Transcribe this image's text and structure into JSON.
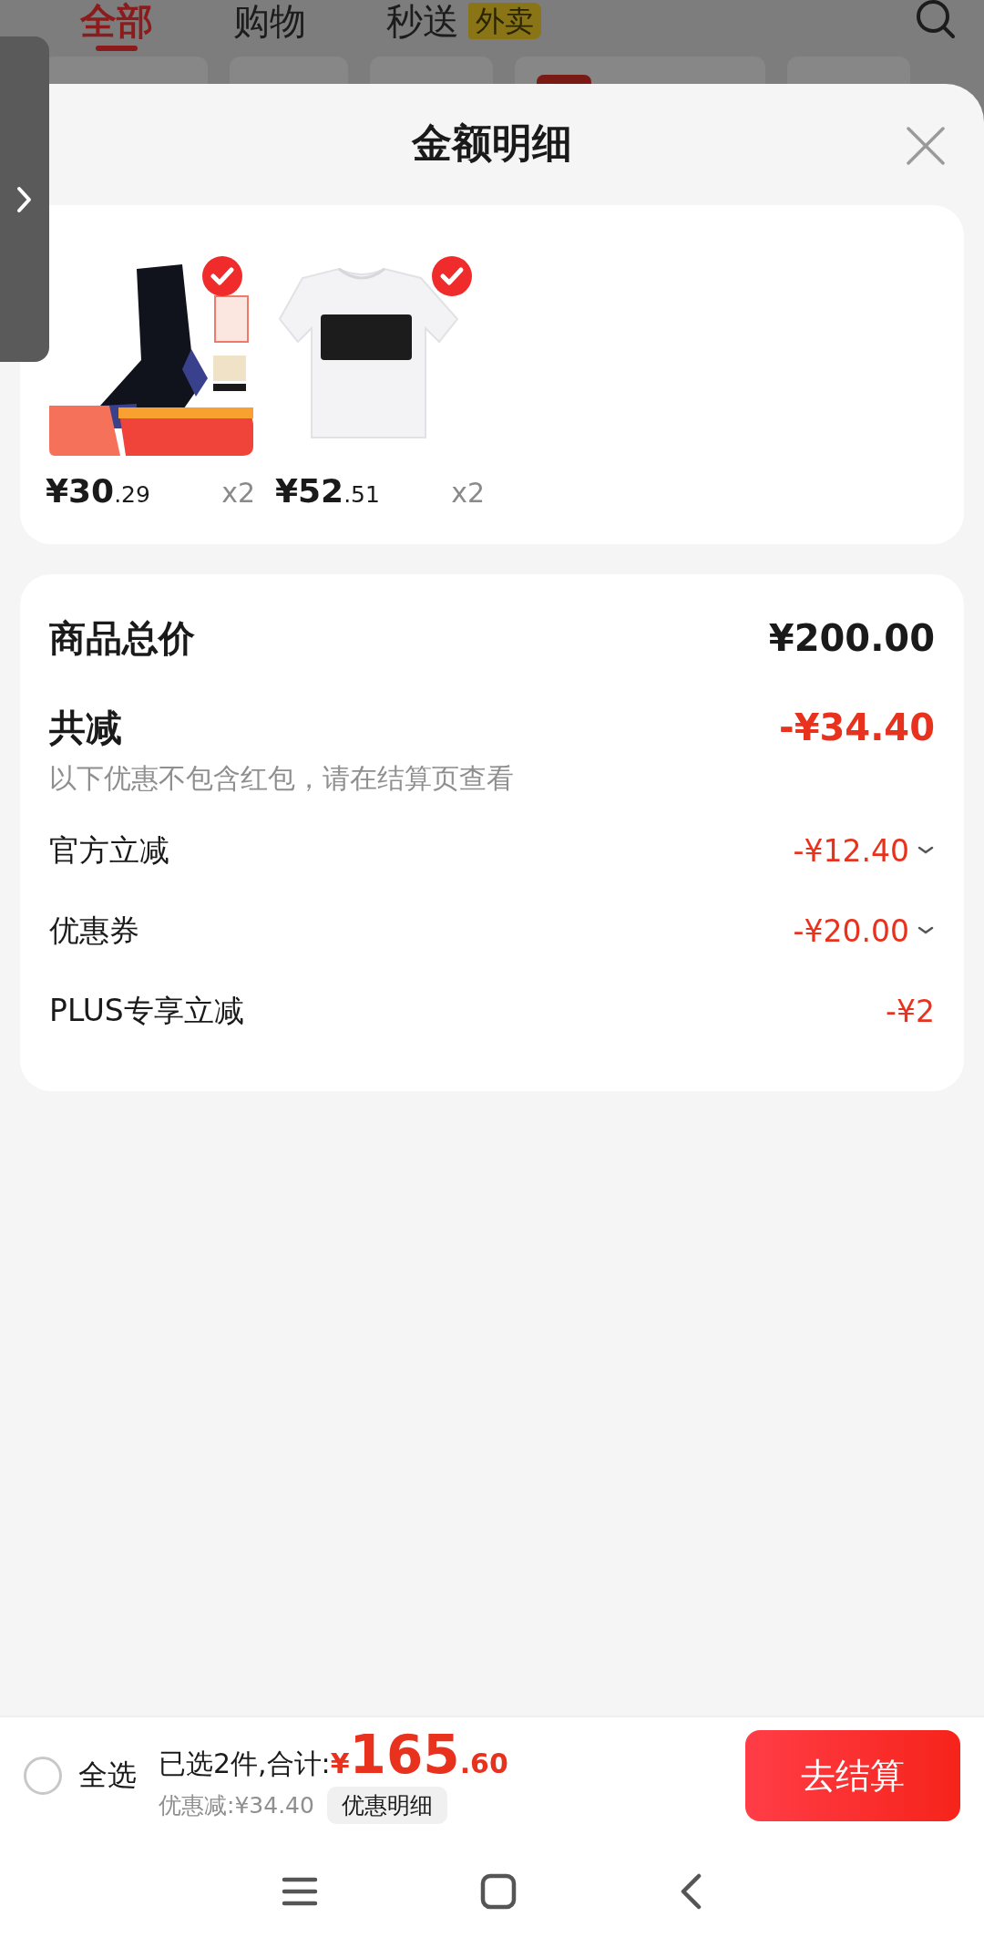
{
  "background_page": {
    "tabs": [
      {
        "label": "全部",
        "selected": true
      },
      {
        "label": "购物",
        "selected": false
      },
      {
        "label": "秒送",
        "badge": "外卖",
        "selected": false
      }
    ],
    "chips": [
      {
        "tagged": false
      },
      {
        "tagged": false
      },
      {
        "tagged": false
      },
      {
        "tagged": true
      },
      {
        "tagged": false
      }
    ]
  },
  "sheet": {
    "title": "金额明细",
    "products": [
      {
        "kind": "socks",
        "price": "¥30",
        "price_cents": ".29",
        "quantity": "x2",
        "selected": true
      },
      {
        "kind": "tshirt",
        "price": "¥52",
        "price_cents": ".51",
        "quantity": "x2",
        "selected": true
      }
    ],
    "summary": [
      {
        "kind": "total",
        "label": "商品总价",
        "amount": "¥200.00"
      },
      {
        "kind": "sum",
        "label": "共减",
        "amount": "-¥34.40",
        "note": "以下优惠不包含红包，请在结算页查看"
      },
      {
        "kind": "discount",
        "label": "官方立减",
        "amount": "-¥12.40",
        "expandable": true
      },
      {
        "kind": "discount",
        "label": "优惠券",
        "amount": "-¥20.00",
        "expandable": true
      },
      {
        "kind": "discount",
        "label": "PLUS专享立减",
        "amount": "-¥2",
        "expandable": false
      }
    ]
  },
  "checkout_bar": {
    "select_all": {
      "label": "全选",
      "checked": false
    },
    "selected_text": "已选2件,合计:",
    "currency": "¥",
    "total": "165",
    "total_cents": ".60",
    "discount": "优惠减:¥34.40",
    "detail_button": "优惠明细",
    "checkout_button": "去结算"
  }
}
